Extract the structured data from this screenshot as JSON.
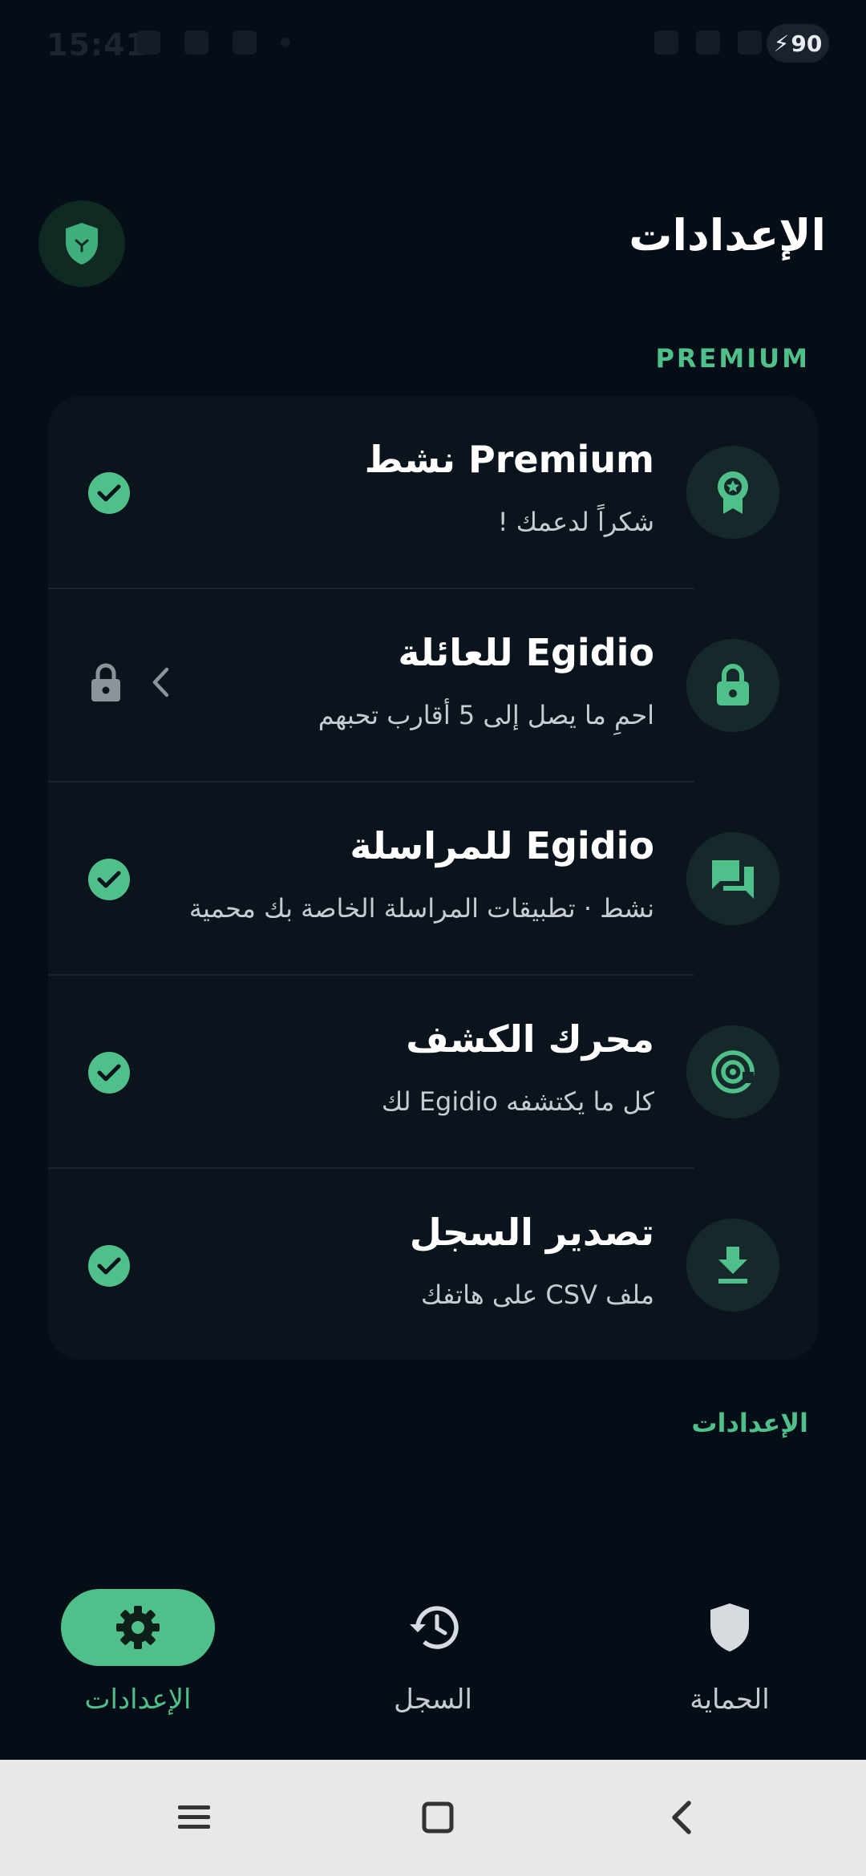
{
  "status_bar": {
    "time": "15:41",
    "battery": "90"
  },
  "header": {
    "title": "الإعدادات"
  },
  "premium_section": {
    "label": "PREMIUM"
  },
  "rows": [
    {
      "title": "Premium نشط",
      "subtitle": "شكراً لدعمك !",
      "icon": "award-star-icon",
      "trailing": "check"
    },
    {
      "title": "Egidio للعائلة",
      "subtitle": "احمِ ما يصل إلى 5 أقارب تحبهم",
      "icon": "lock-icon",
      "trailing": "lock-chevron"
    },
    {
      "title": "Egidio للمراسلة",
      "subtitle": "نشط · تطبيقات المراسلة الخاصة بك محمية",
      "icon": "chat-icon",
      "trailing": "check"
    },
    {
      "title": "محرك الكشف",
      "subtitle": "كل ما يكتشفه Egidio لك",
      "icon": "at-target-icon",
      "trailing": "check"
    },
    {
      "title": "تصدير السجل",
      "subtitle": "ملف CSV على هاتفك",
      "icon": "download-icon",
      "trailing": "check"
    }
  ],
  "settings_section": {
    "label": "الإعدادات"
  },
  "bottom_nav": {
    "items": [
      {
        "label": "الإعدادات",
        "icon": "gear-icon",
        "active": true
      },
      {
        "label": "السجل",
        "icon": "history-icon",
        "active": false
      },
      {
        "label": "الحماية",
        "icon": "shield-icon",
        "active": false
      }
    ]
  },
  "colors": {
    "accent": "#4fc08a",
    "background": "#050d17",
    "card": "#0b141d"
  }
}
